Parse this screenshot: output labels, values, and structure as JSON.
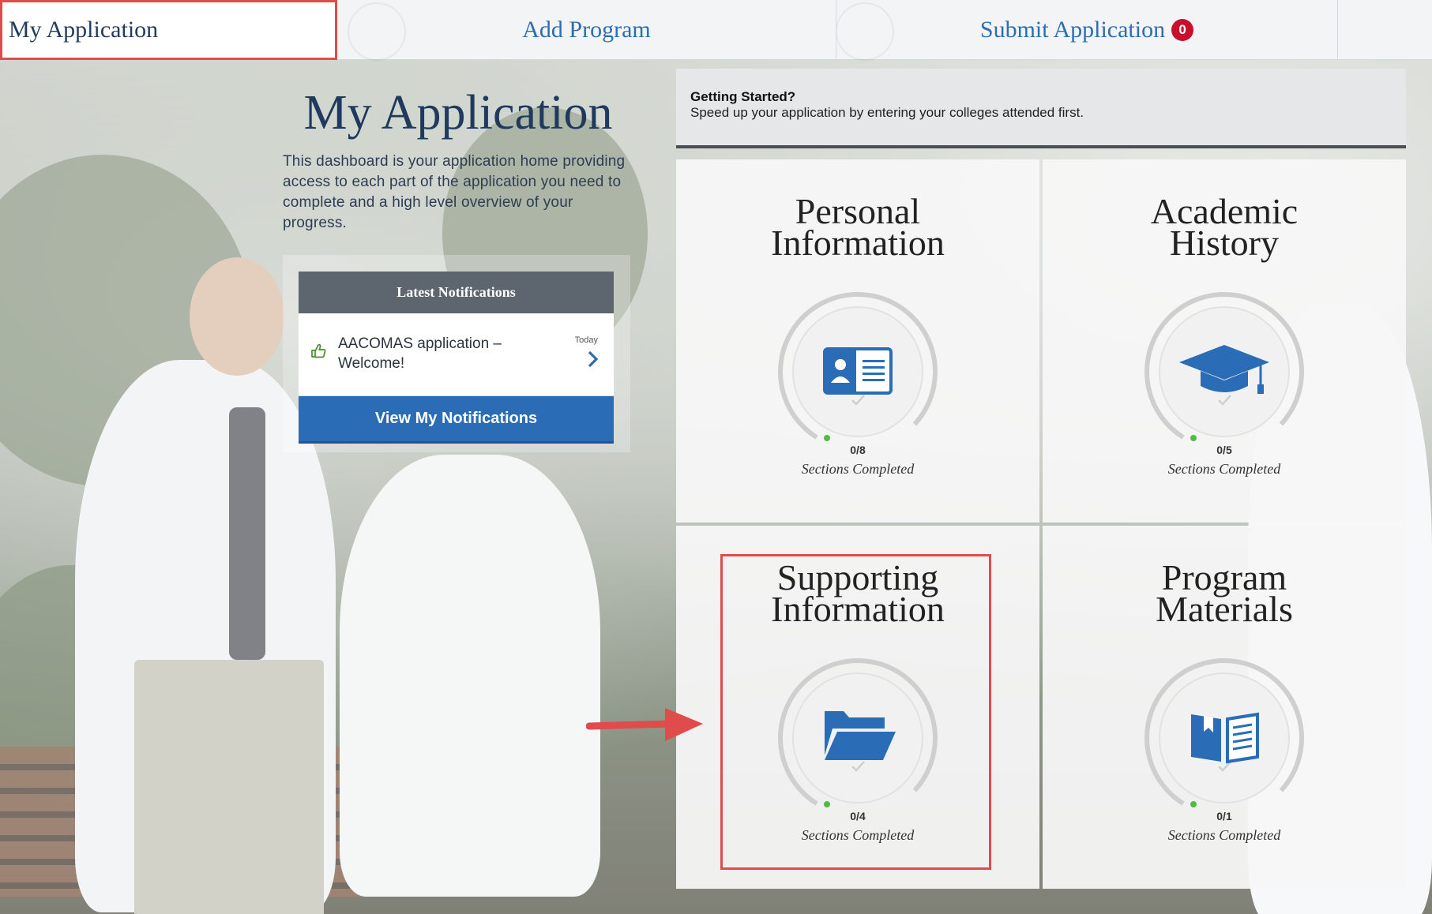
{
  "nav": {
    "tabs": [
      {
        "label": "My Application"
      },
      {
        "label": "Add Program"
      },
      {
        "label": "Submit Application",
        "badge": "0"
      }
    ]
  },
  "intro": {
    "title": "My Application",
    "description": "This dashboard is your application home providing access to each part of the application you need to complete and a high level overview of your progress."
  },
  "notifications": {
    "header": "Latest Notifications",
    "items": [
      {
        "message": "AACOMAS application – Welcome!",
        "date": "Today"
      }
    ],
    "button_label": "View My Notifications"
  },
  "getting_started": {
    "title": "Getting Started?",
    "text": "Speed up your application by entering your colleges attended first."
  },
  "cards": [
    {
      "title_line1": "Personal",
      "title_line2": "Information",
      "count": "0/8",
      "label": "Sections Completed",
      "icon": "id-card-icon"
    },
    {
      "title_line1": "Academic",
      "title_line2": "History",
      "count": "0/5",
      "label": "Sections Completed",
      "icon": "graduation-cap-icon"
    },
    {
      "title_line1": "Supporting",
      "title_line2": "Information",
      "count": "0/4",
      "label": "Sections Completed",
      "icon": "folder-icon"
    },
    {
      "title_line1": "Program",
      "title_line2": "Materials",
      "count": "0/1",
      "label": "Sections Completed",
      "icon": "book-icon"
    }
  ],
  "colors": {
    "accent_blue": "#2a6cb5",
    "badge_red": "#c8102e",
    "annotation_red": "#e04b4b",
    "progress_dot": "#55b848"
  }
}
